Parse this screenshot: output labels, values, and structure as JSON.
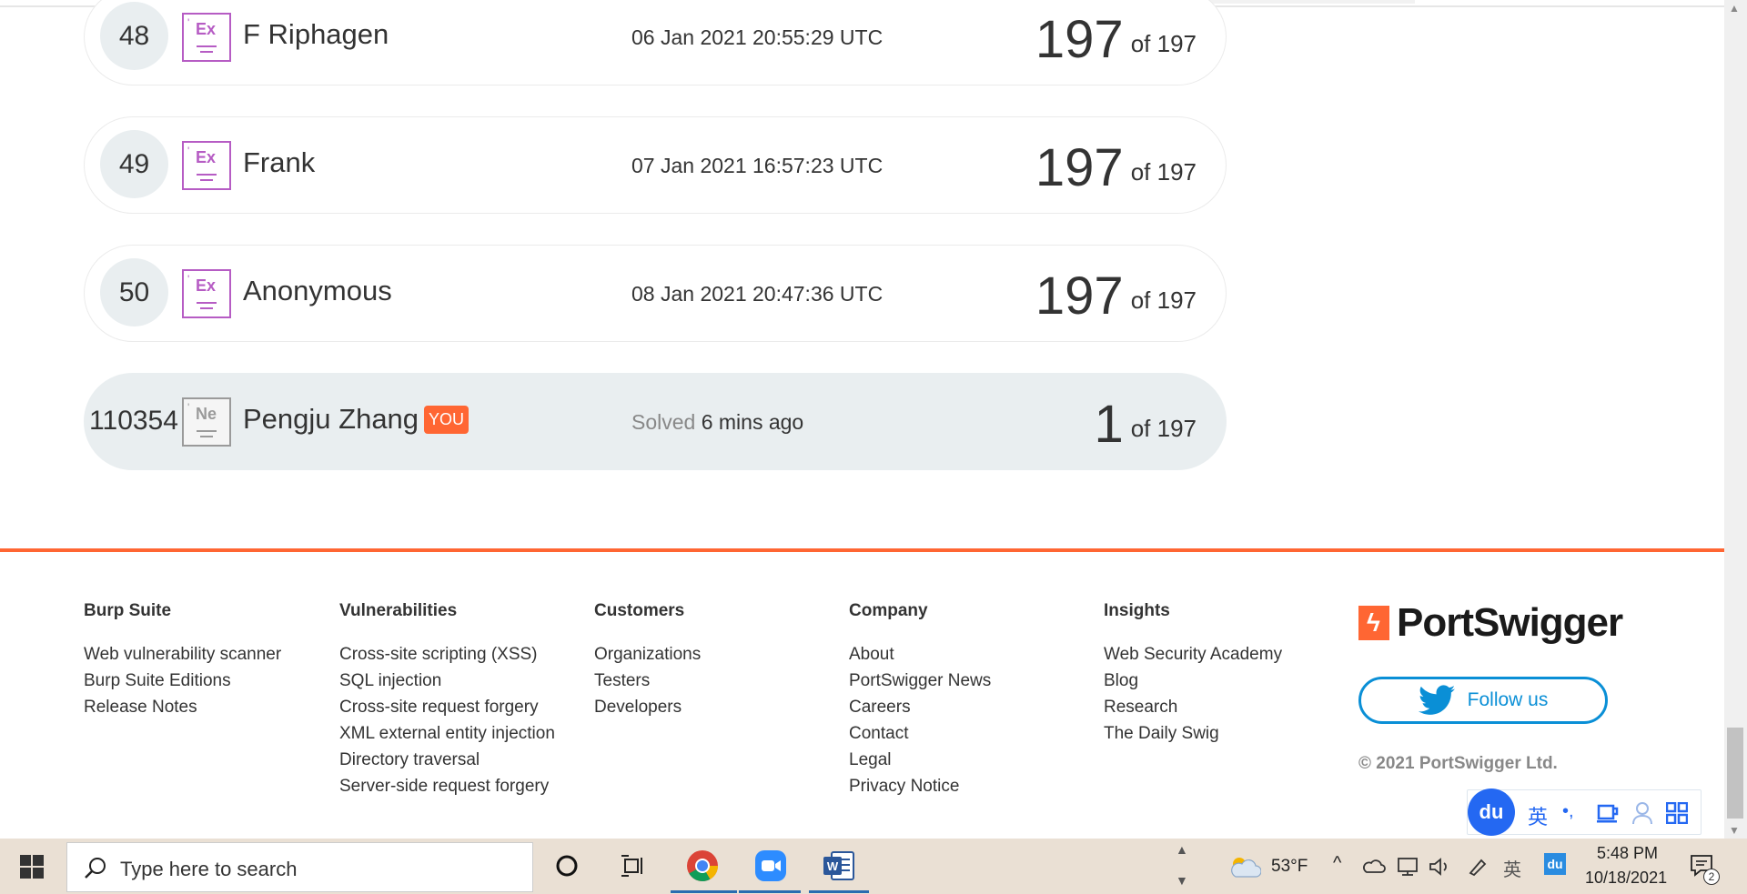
{
  "leaderboard": {
    "rows": [
      {
        "rank": "48",
        "level": "Ex",
        "name": "F Riphagen",
        "date": "06 Jan 2021 20:55:29 UTC",
        "score": "197",
        "of": "of 197"
      },
      {
        "rank": "49",
        "level": "Ex",
        "name": "Frank",
        "date": "07 Jan 2021 16:57:23 UTC",
        "score": "197",
        "of": "of 197"
      },
      {
        "rank": "50",
        "level": "Ex",
        "name": "Anonymous",
        "date": "08 Jan 2021 20:47:36 UTC",
        "score": "197",
        "of": "of 197"
      }
    ],
    "you": {
      "rank": "110354",
      "level": "Ne",
      "name": "Pengju Zhang",
      "badge": "YOU",
      "solved_label": "Solved",
      "solved_time": "6 mins ago",
      "score": "1",
      "of": "of 197"
    }
  },
  "footer": {
    "burp": {
      "heading": "Burp Suite",
      "links": [
        "Web vulnerability scanner",
        "Burp Suite Editions",
        "Release Notes"
      ]
    },
    "vulns": {
      "heading": "Vulnerabilities",
      "links": [
        "Cross-site scripting (XSS)",
        "SQL injection",
        "Cross-site request forgery",
        "XML external entity injection",
        "Directory traversal",
        "Server-side request forgery"
      ]
    },
    "customers": {
      "heading": "Customers",
      "links": [
        "Organizations",
        "Testers",
        "Developers"
      ]
    },
    "company": {
      "heading": "Company",
      "links": [
        "About",
        "PortSwigger News",
        "Careers",
        "Contact",
        "Legal",
        "Privacy Notice"
      ]
    },
    "insights": {
      "heading": "Insights",
      "links": [
        "Web Security Academy",
        "Blog",
        "Research",
        "The Daily Swig"
      ]
    },
    "brand": "PortSwigger",
    "follow_label": "Follow us",
    "copyright": "© 2021 PortSwigger Ltd."
  },
  "ime": {
    "logo": "du",
    "lang": "英",
    "punct": "•,"
  },
  "taskbar": {
    "search_placeholder": "Type here to search",
    "weather": "53°F",
    "time": "5:48 PM",
    "date": "10/18/2021",
    "notifications": "2"
  },
  "colors": {
    "accent": "#ff6633",
    "level_expert": "#b65cc4",
    "twitter": "#0a8fd6",
    "row_you_bg": "#e9eef0"
  }
}
